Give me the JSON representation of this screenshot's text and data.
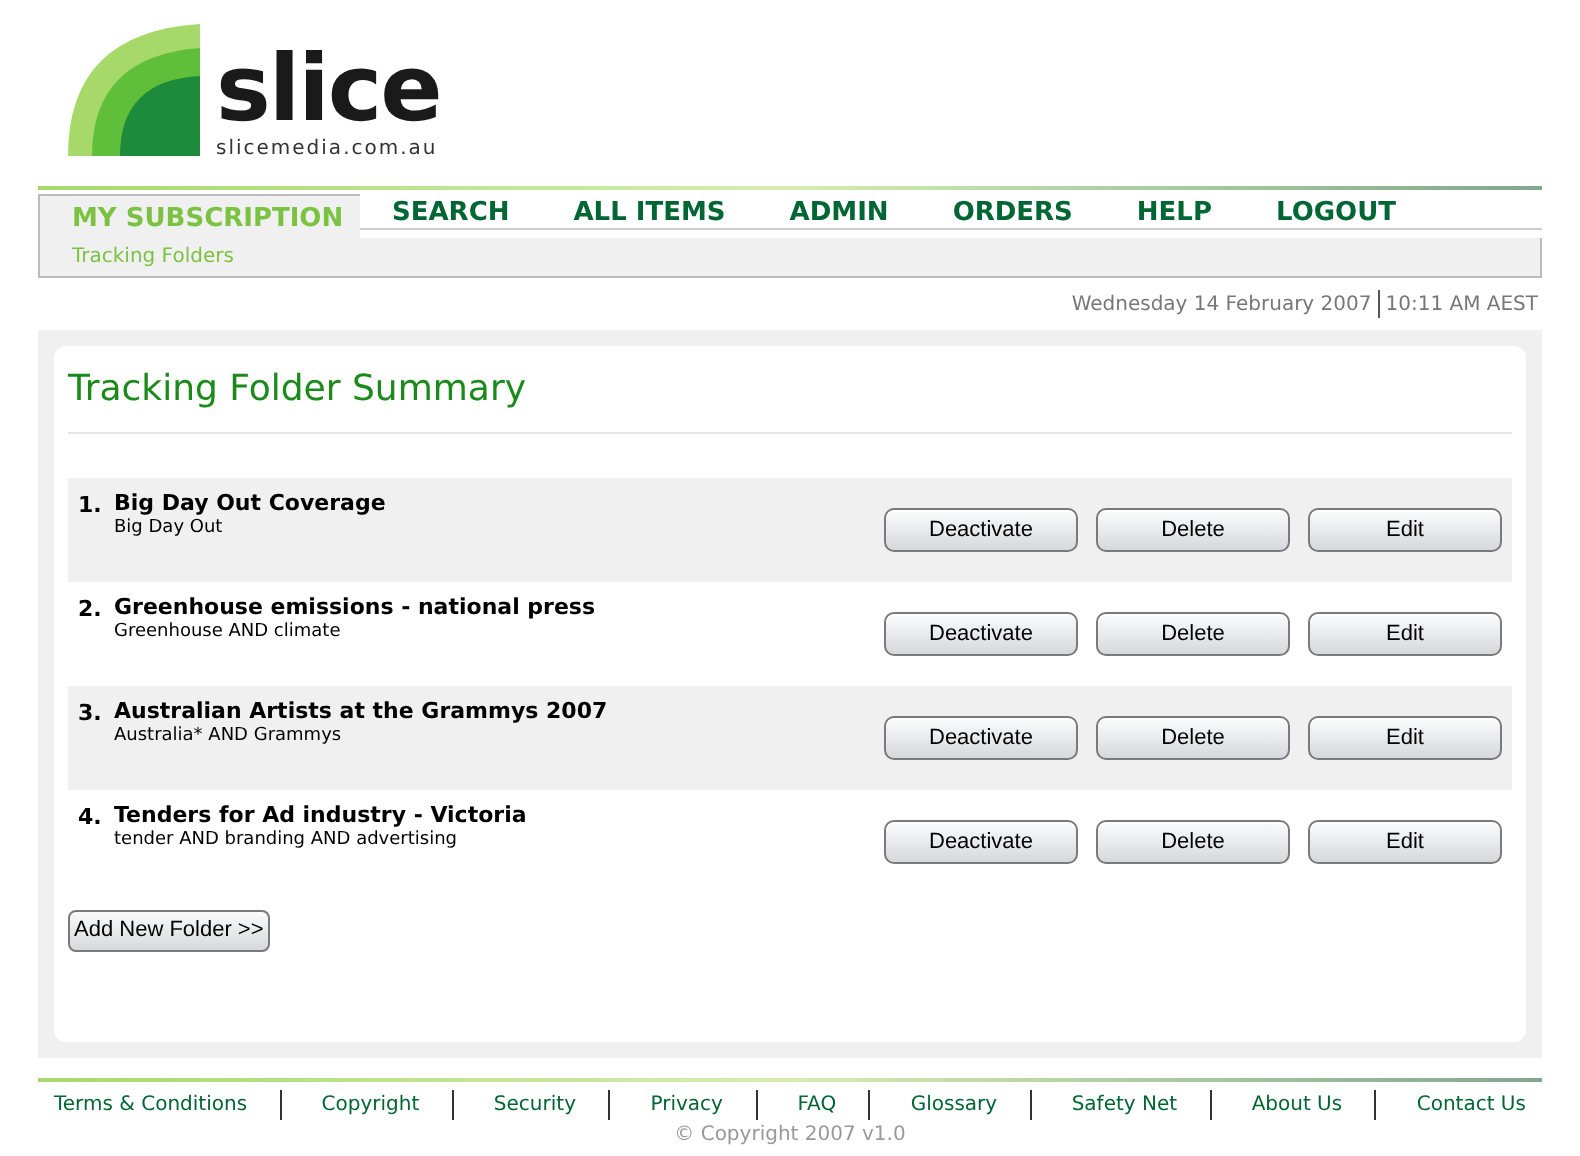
{
  "logo": {
    "wordmark": "slice",
    "domain": "slicemedia.com.au"
  },
  "nav": {
    "tabs": [
      {
        "label": "MY SUBSCRIPTION",
        "selected": true
      },
      {
        "label": "SEARCH",
        "selected": false
      },
      {
        "label": "ALL ITEMS",
        "selected": false
      },
      {
        "label": "ADMIN",
        "selected": false
      },
      {
        "label": "ORDERS",
        "selected": false
      },
      {
        "label": "HELP",
        "selected": false
      },
      {
        "label": "LOGOUT",
        "selected": false
      }
    ],
    "subnav": [
      "Tracking Folders"
    ]
  },
  "datetime": {
    "date": "Wednesday 14 February 2007",
    "time": "10:11 AM AEST"
  },
  "heading": "Tracking Folder Summary",
  "folders": [
    {
      "number": "1.",
      "title": "Big Day Out Coverage",
      "query": "Big Day Out",
      "actions": [
        "Deactivate",
        "Delete",
        "Edit"
      ]
    },
    {
      "number": "2.",
      "title": "Greenhouse emissions - national press",
      "query": "Greenhouse AND climate",
      "actions": [
        "Deactivate",
        "Delete",
        "Edit"
      ]
    },
    {
      "number": "3.",
      "title": "Australian Artists at the Grammys 2007",
      "query": "Australia* AND Grammys",
      "actions": [
        "Deactivate",
        "Delete",
        "Edit"
      ]
    },
    {
      "number": "4.",
      "title": "Tenders for Ad industry - Victoria",
      "query": "tender AND branding AND advertising",
      "actions": [
        "Deactivate",
        "Delete",
        "Edit"
      ]
    }
  ],
  "add_button": "Add New Folder >>",
  "footer": {
    "links": [
      "Terms & Conditions",
      "Copyright",
      "Security",
      "Privacy",
      "FAQ",
      "Glossary",
      "Safety Net",
      "About Us",
      "Contact Us"
    ],
    "copyright": "© Copyright 2007 v1.0"
  }
}
